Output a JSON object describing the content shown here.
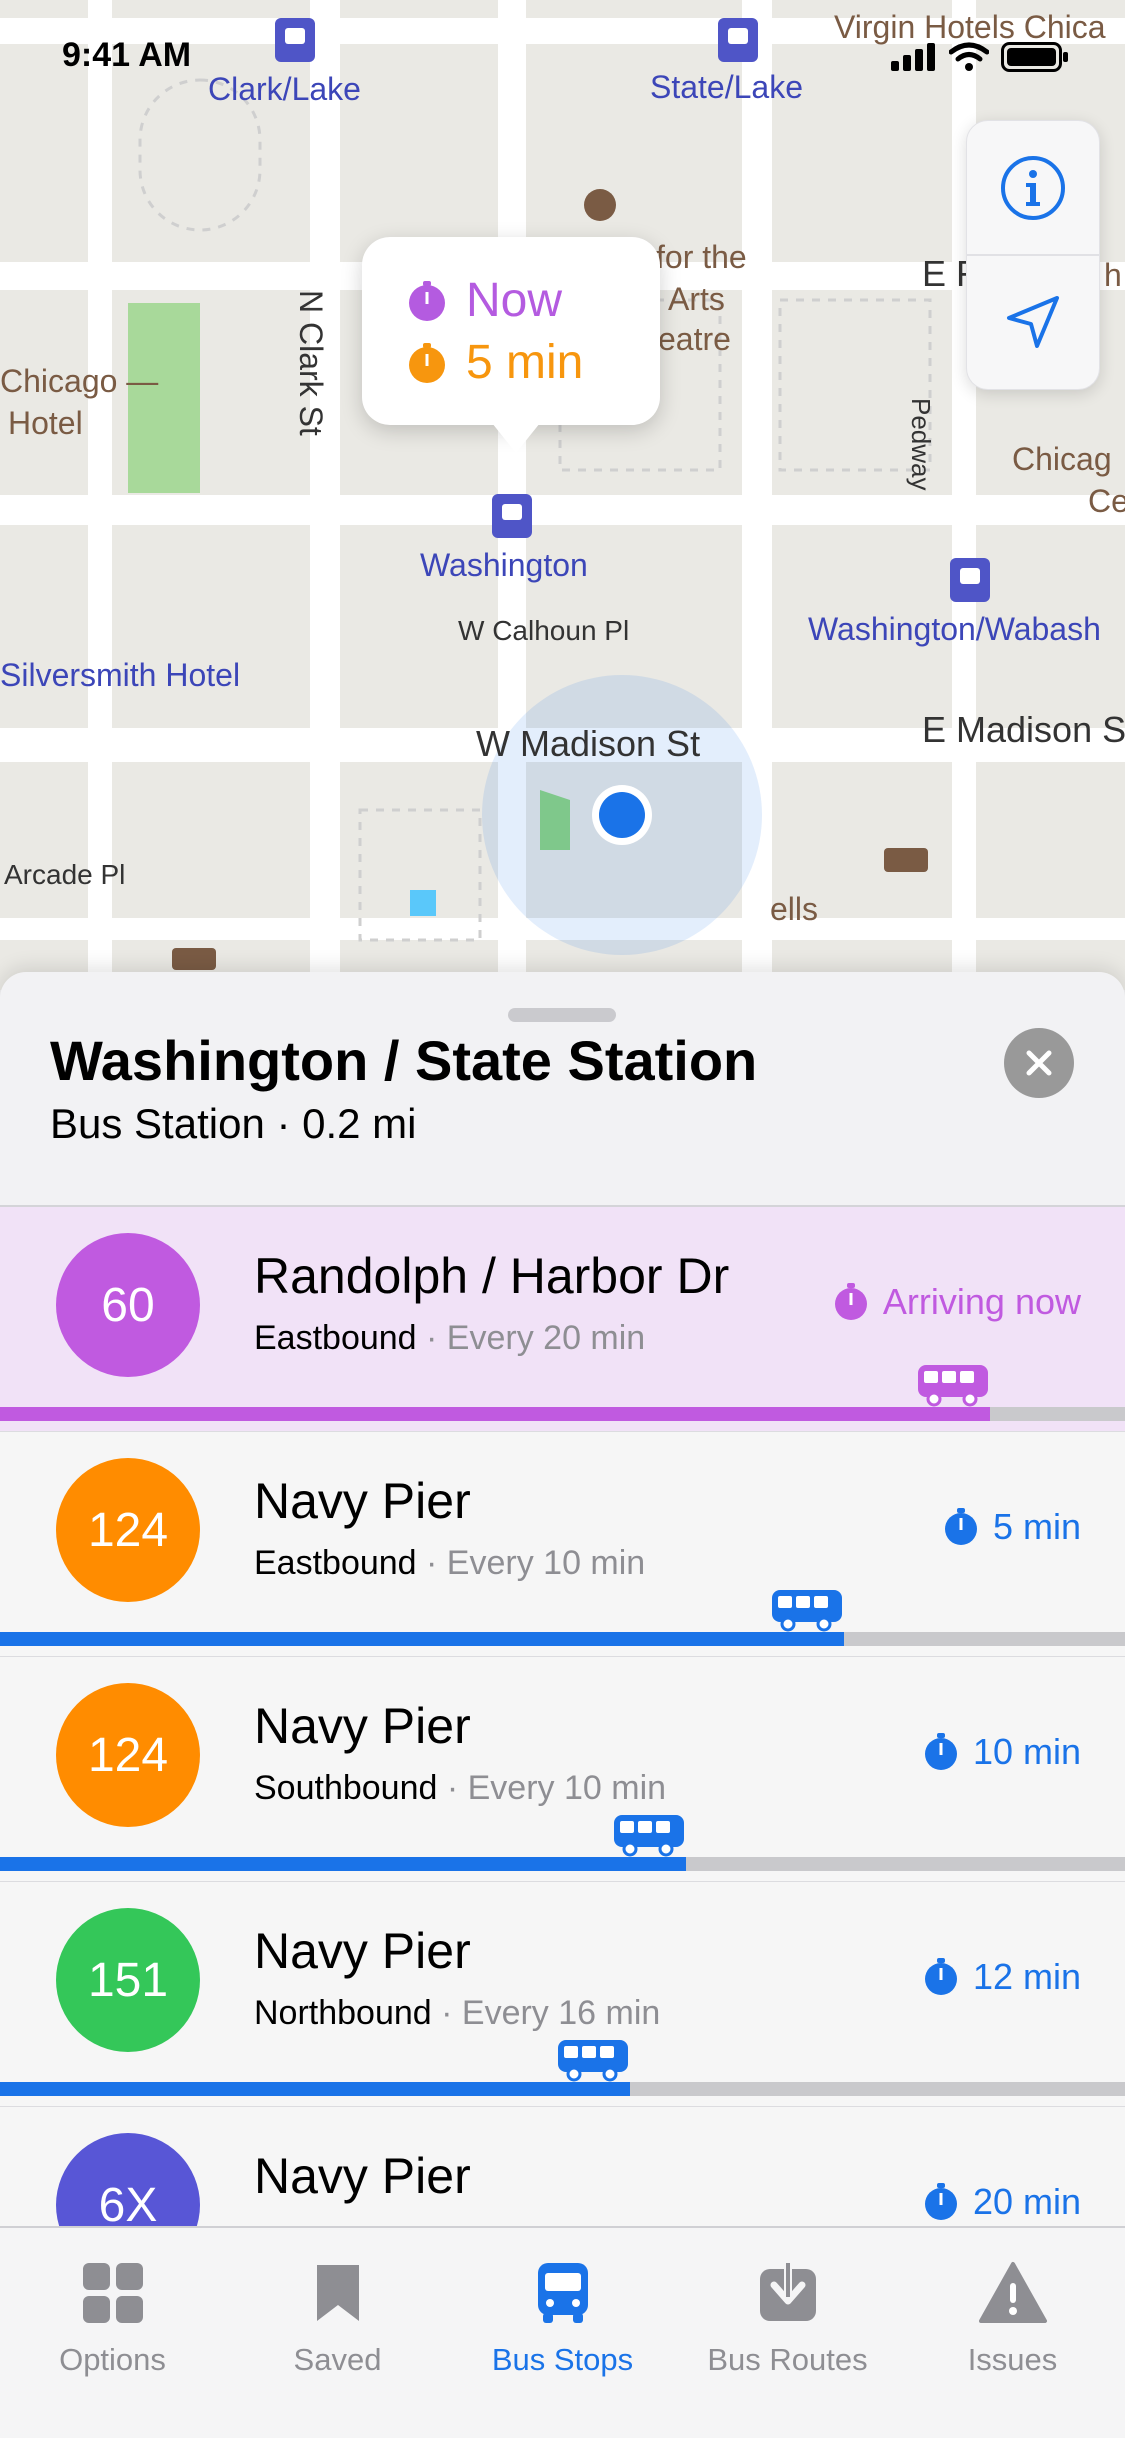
{
  "status_bar": {
    "time": "9:41 AM"
  },
  "map": {
    "streets": [
      "N Clark St",
      "W Calhoun Pl",
      "W Madison St",
      "E Madison St",
      "Pedway",
      "Arcade Pl",
      "E F"
    ],
    "stations": [
      "Clark/Lake",
      "State/Lake",
      "Washington",
      "Washington/Wabash"
    ],
    "places": [
      "Virgin Hotels Chica",
      "for the",
      "Arts",
      "eatre",
      "Chicago —",
      "Hotel",
      "Chicag",
      "Ce",
      "ells",
      "Silversmith Hotel",
      "h"
    ],
    "callout": {
      "now": "Now",
      "later": "5 min"
    }
  },
  "sheet": {
    "title": "Washington / State Station",
    "subtitle": "Bus Station · 0.2 mi"
  },
  "routes": [
    {
      "number": "60",
      "destination": "Randolph / Harbor Dr",
      "direction": "Eastbound",
      "frequency": " · Every 20 min",
      "eta": "Arriving now",
      "progress": 0.88,
      "color": "#c05ae0"
    },
    {
      "number": "124",
      "destination": "Navy Pier",
      "direction": "Eastbound",
      "frequency": " · Every 10 min",
      "eta": "5 min",
      "progress": 0.75,
      "color": "#ff8c00"
    },
    {
      "number": "124",
      "destination": "Navy Pier",
      "direction": "Southbound",
      "frequency": " · Every 10 min",
      "eta": "10 min",
      "progress": 0.61,
      "color": "#ff8c00"
    },
    {
      "number": "151",
      "destination": "Navy Pier",
      "direction": "Northbound",
      "frequency": " · Every 16 min",
      "eta": "12 min",
      "progress": 0.56,
      "color": "#34c759"
    },
    {
      "number": "6X",
      "destination": "Navy Pier",
      "direction": "",
      "frequency": "",
      "eta": "20 min",
      "progress": 0.5,
      "color": "#5856d6"
    }
  ],
  "tabs": [
    {
      "label": "Options",
      "icon": "grid-icon"
    },
    {
      "label": "Saved",
      "icon": "bookmark-icon"
    },
    {
      "label": "Bus Stops",
      "icon": "bus-icon"
    },
    {
      "label": "Bus Routes",
      "icon": "download-icon"
    },
    {
      "label": "Issues",
      "icon": "warning-icon"
    }
  ],
  "colors": {
    "accent": "#1a73e8",
    "arriving": "#c05ae0",
    "progress_blue": "#1a73e8"
  }
}
